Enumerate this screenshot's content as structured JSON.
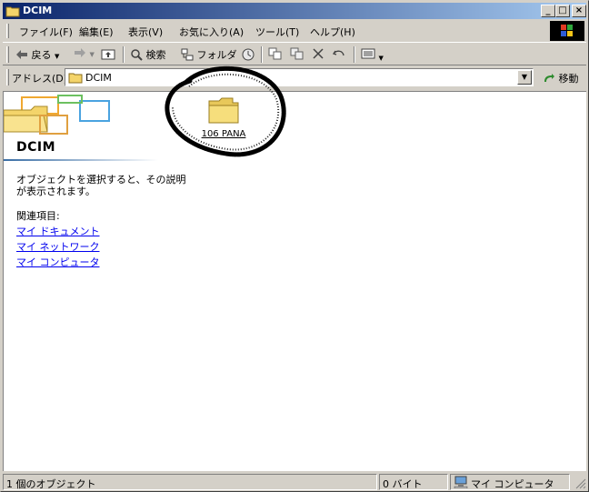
{
  "window": {
    "title": "DCIM",
    "controls": [
      "_",
      "□",
      "×"
    ]
  },
  "menu": {
    "items": [
      "ファイル(F)",
      "編集(E)",
      "表示(V)",
      "お気に入り(A)",
      "ツール(T)",
      "ヘルプ(H)"
    ]
  },
  "toolbar": {
    "back": "戻る",
    "search": "検索",
    "folders": "フォルダ"
  },
  "address": {
    "label": "アドレス(D)",
    "value": "DCIM",
    "go": "移動"
  },
  "sidebar": {
    "title": "DCIM",
    "description": "オブジェクトを選択すると、その説明が表示されます。",
    "related_label": "関連項目:",
    "links": [
      "マイ ドキュメント",
      "マイ ネットワーク",
      "マイ コンピュータ"
    ]
  },
  "files": [
    {
      "name": "106 PANA",
      "icon": "folder-icon"
    }
  ],
  "status": {
    "objects": "1 個のオブジェクト",
    "size": "0 バイト",
    "zone": "マイ コンピュータ"
  }
}
